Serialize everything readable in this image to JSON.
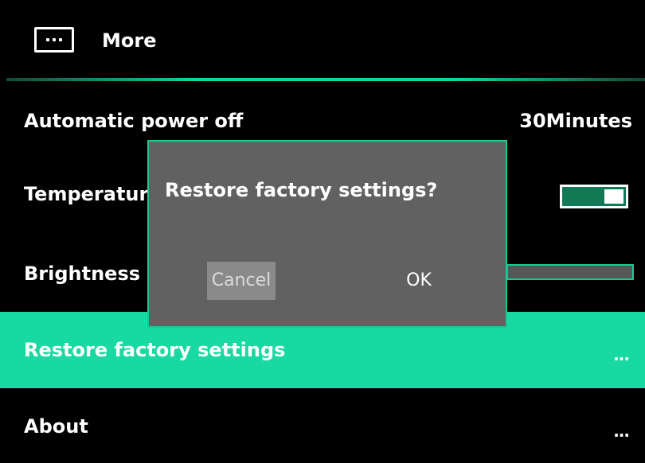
{
  "header": {
    "icon": "more-dots-icon",
    "title": "More"
  },
  "settings": {
    "items": [
      {
        "label": "Automatic power off",
        "value": "30Minutes"
      },
      {
        "label": "Temperature",
        "toggle_on": true
      },
      {
        "label": "Brightness",
        "level": 0
      },
      {
        "label": "Restore factory settings",
        "value": "..."
      },
      {
        "label": "About",
        "value": "..."
      }
    ],
    "selected_index": 3
  },
  "dialog": {
    "message": "Restore factory settings?",
    "cancel_label": "Cancel",
    "ok_label": "OK"
  },
  "colors": {
    "background": "#000000",
    "accent": "#18d9a1",
    "dialog_bg": "#616161",
    "cancel_bg": "#8a8a8a"
  }
}
